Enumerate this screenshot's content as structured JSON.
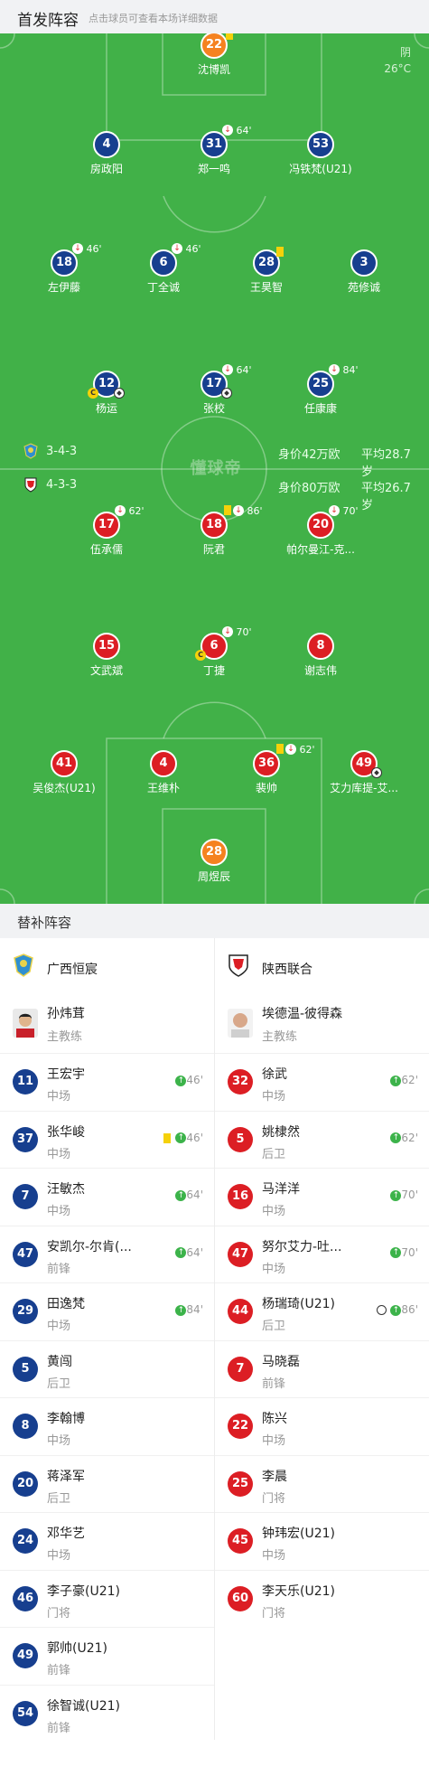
{
  "header": {
    "title": "首发阵容",
    "hint": "点击球员可查看本场详细数据"
  },
  "weather": {
    "condition": "阴",
    "temperature": "26°C"
  },
  "watermark": "懂球帝",
  "home_team": {
    "formation": "3-4-3",
    "market_value": "身价42万欧",
    "avg_age": "平均28.7岁"
  },
  "away_team": {
    "formation": "4-3-3",
    "market_value": "身价80万欧",
    "avg_age": "平均26.7岁"
  },
  "pitch_players": {
    "h22": {
      "number": "22",
      "name": "沈博凯"
    },
    "h4": {
      "number": "4",
      "name": "房政阳"
    },
    "h31": {
      "number": "31",
      "name": "郑一鸣",
      "sub_minute": "64'"
    },
    "h53": {
      "number": "53",
      "name": "冯铁梵(U21)"
    },
    "h18": {
      "number": "18",
      "name": "左伊藤",
      "sub_minute": "46'"
    },
    "h6": {
      "number": "6",
      "name": "丁全诚",
      "sub_minute": "46'"
    },
    "h28": {
      "number": "28",
      "name": "王昊智"
    },
    "h3": {
      "number": "3",
      "name": "苑修诚"
    },
    "h12": {
      "number": "12",
      "name": "杨运",
      "captain": "C"
    },
    "h17": {
      "number": "17",
      "name": "张校",
      "sub_minute": "64'"
    },
    "h25": {
      "number": "25",
      "name": "任康康",
      "sub_minute": "84'"
    },
    "a17": {
      "number": "17",
      "name": "伍承儒",
      "sub_minute": "62'"
    },
    "a18": {
      "number": "18",
      "name": "阮君",
      "sub_minute": "86'"
    },
    "a20": {
      "number": "20",
      "name": "帕尔曼江-克...",
      "sub_minute": "70'"
    },
    "a15": {
      "number": "15",
      "name": "文武斌"
    },
    "a6": {
      "number": "6",
      "name": "丁捷",
      "sub_minute": "70'",
      "captain": "C"
    },
    "a8": {
      "number": "8",
      "name": "谢志伟"
    },
    "a41": {
      "number": "41",
      "name": "吴俊杰(U21)"
    },
    "a4": {
      "number": "4",
      "name": "王维朴"
    },
    "a36": {
      "number": "36",
      "name": "裴帅",
      "sub_minute": "62'"
    },
    "a49": {
      "number": "49",
      "name": "艾力库提-艾..."
    },
    "a28": {
      "number": "28",
      "name": "周煜辰"
    }
  },
  "subs": {
    "title": "替补阵容",
    "left": {
      "team_name": "广西恒宸",
      "coach": {
        "name": "孙炜茸",
        "role": "主教练"
      },
      "players": [
        {
          "number": "11",
          "name": "王宏宇",
          "pos": "中场",
          "minute": "46'"
        },
        {
          "number": "37",
          "name": "张华峻",
          "pos": "中场",
          "minute": "46'"
        },
        {
          "number": "7",
          "name": "汪敏杰",
          "pos": "中场",
          "minute": "64'"
        },
        {
          "number": "47",
          "name": "安凯尔-尔肯(...",
          "pos": "前锋",
          "minute": "64'"
        },
        {
          "number": "29",
          "name": "田逸梵",
          "pos": "中场",
          "minute": "84'"
        },
        {
          "number": "5",
          "name": "黄闯",
          "pos": "后卫"
        },
        {
          "number": "8",
          "name": "李翰博",
          "pos": "中场"
        },
        {
          "number": "20",
          "name": "蒋泽军",
          "pos": "后卫"
        },
        {
          "number": "24",
          "name": "邓华艺",
          "pos": "中场"
        },
        {
          "number": "46",
          "name": "李子豪(U21)",
          "pos": "门将"
        },
        {
          "number": "49",
          "name": "郭帅(U21)",
          "pos": "前锋"
        },
        {
          "number": "54",
          "name": "徐智诚(U21)",
          "pos": "前锋"
        }
      ]
    },
    "right": {
      "team_name": "陕西联合",
      "coach": {
        "name": "埃德温-彼得森",
        "role": "主教练"
      },
      "players": [
        {
          "number": "32",
          "name": "徐武",
          "pos": "中场",
          "minute": "62'"
        },
        {
          "number": "5",
          "name": "姚棣然",
          "pos": "后卫",
          "minute": "62'"
        },
        {
          "number": "16",
          "name": "马洋洋",
          "pos": "中场",
          "minute": "70'"
        },
        {
          "number": "47",
          "name": "努尔艾力-吐...",
          "pos": "中场",
          "minute": "70'"
        },
        {
          "number": "44",
          "name": "杨瑞琦(U21)",
          "pos": "后卫",
          "minute": "86'"
        },
        {
          "number": "7",
          "name": "马晓磊",
          "pos": "前锋"
        },
        {
          "number": "22",
          "name": "陈兴",
          "pos": "中场"
        },
        {
          "number": "25",
          "name": "李晨",
          "pos": "门将"
        },
        {
          "number": "45",
          "name": "钟玮宏(U21)",
          "pos": "中场"
        },
        {
          "number": "60",
          "name": "李天乐(U21)",
          "pos": "门将"
        }
      ]
    }
  },
  "colors": {
    "pitch": "#41b148",
    "home": "#173f8f",
    "away": "#dc1e24",
    "goalkeeper": "#f58220",
    "sub_in": "#3cb34a",
    "yellow_card": "#f5d10a"
  }
}
